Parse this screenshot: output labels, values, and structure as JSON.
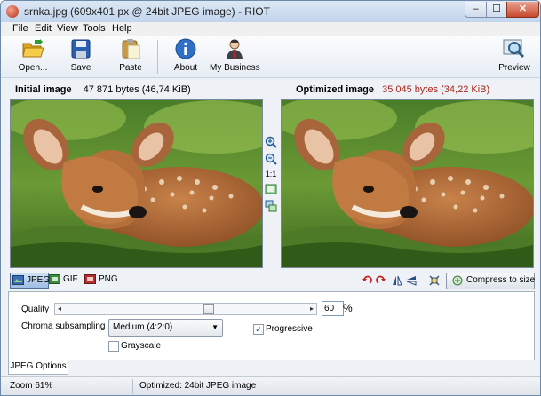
{
  "window": {
    "title": "srnka.jpg (609x401 px @ 24bit JPEG image) - RIOT",
    "minimize_glyph": "‒",
    "maximize_glyph": "☐",
    "close_glyph": "✕"
  },
  "menu": [
    {
      "label": "File"
    },
    {
      "label": "Edit"
    },
    {
      "label": "View"
    },
    {
      "label": "Tools"
    },
    {
      "label": "Help"
    }
  ],
  "toolbar": {
    "open": {
      "label": "Open...",
      "icon": "folder-open-icon"
    },
    "save": {
      "label": "Save",
      "icon": "floppy-disk-icon"
    },
    "paste": {
      "label": "Paste",
      "icon": "clipboard-icon"
    },
    "about": {
      "label": "About",
      "icon": "info-icon"
    },
    "business": {
      "label": "My Business",
      "icon": "businessman-icon"
    },
    "preview": {
      "label": "Preview",
      "icon": "magnifier-preview-icon"
    }
  },
  "initial": {
    "label": "Initial image",
    "size": "47 871 bytes (46,74 KiB)"
  },
  "optimized": {
    "label": "Optimized image",
    "size": "35 045 bytes (34,22 KiB)",
    "size_color": "#a8251b"
  },
  "middle_tools": {
    "zoom_in": "zoom-in-icon",
    "zoom_out": "zoom-out-icon",
    "actual_size_label": "1:1",
    "fit": "fit-window-icon",
    "sync": "sync-views-icon"
  },
  "formats": [
    {
      "label": "JPEG",
      "active": true
    },
    {
      "label": "GIF",
      "active": false
    },
    {
      "label": "PNG",
      "active": false
    }
  ],
  "image_tools": [
    "rotate-left-icon",
    "rotate-right-icon",
    "flip-horizontal-icon",
    "flip-vertical-icon",
    "crop-resize-icon"
  ],
  "compress_button": {
    "label": "Compress to size"
  },
  "options": {
    "quality_label": "Quality",
    "quality_value": "60",
    "quality_fraction": 0.6,
    "quality_unit": "%",
    "chroma_label": "Chroma subsampling",
    "chroma_value": "Medium (4:2:0)",
    "progressive_label": "Progressive",
    "progressive_checked": true,
    "grayscale_label": "Grayscale",
    "grayscale_checked": false
  },
  "bottom_tab": "JPEG Options",
  "status": {
    "zoom": "Zoom 61%",
    "message": "Optimized: 24bit JPEG image"
  }
}
